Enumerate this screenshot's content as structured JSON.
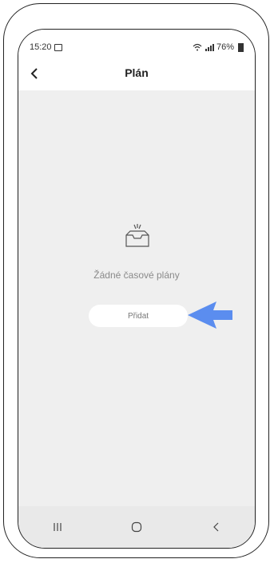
{
  "status_bar": {
    "time": "15:20",
    "battery": "76%",
    "icons": [
      "gallery-icon",
      "wifi-icon",
      "signal-icon",
      "battery-icon"
    ]
  },
  "header": {
    "title": "Plán",
    "back_icon": "chevron-left-icon"
  },
  "main": {
    "empty_icon": "inbox-icon",
    "empty_text": "Žádné časové plány",
    "add_button_label": "Přidat",
    "annotation_icon": "arrow-left-icon"
  },
  "bottom_nav": {
    "icons": [
      "recent-apps-icon",
      "home-icon",
      "back-icon"
    ]
  },
  "colors": {
    "background": "#efefef",
    "topbar": "#ffffff",
    "annotation_arrow": "#5b8def",
    "text_muted": "#8a8a8a"
  }
}
